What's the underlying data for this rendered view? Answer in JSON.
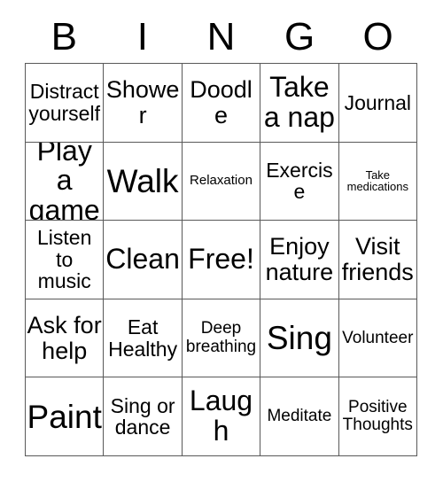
{
  "card": {
    "title_letters": [
      "B",
      "I",
      "N",
      "G",
      "O"
    ],
    "border_color": "#595959",
    "background_color": "#ffffff",
    "text_color": "#000000"
  },
  "cells": [
    {
      "text": "Distract yourself",
      "size": "md"
    },
    {
      "text": "Shower",
      "size": "lg"
    },
    {
      "text": "Doodle",
      "size": "lg"
    },
    {
      "text": "Take a nap",
      "size": "xl"
    },
    {
      "text": "Journal",
      "size": "md"
    },
    {
      "text": "Play a game",
      "size": "xl"
    },
    {
      "text": "Walk",
      "size": "xxl"
    },
    {
      "text": "Relaxation",
      "size": "xs"
    },
    {
      "text": "Exercise",
      "size": "md"
    },
    {
      "text": "Take medications",
      "size": "xxs"
    },
    {
      "text": "Listen to music",
      "size": "md"
    },
    {
      "text": "Clean",
      "size": "xl"
    },
    {
      "text": "Free!",
      "size": "xl"
    },
    {
      "text": "Enjoy nature",
      "size": "lg"
    },
    {
      "text": "Visit friends",
      "size": "lg"
    },
    {
      "text": "Ask for help",
      "size": "lg"
    },
    {
      "text": "Eat Healthy",
      "size": "md"
    },
    {
      "text": "Deep breathing",
      "size": "sm"
    },
    {
      "text": "Sing",
      "size": "xxl"
    },
    {
      "text": "Volunteer",
      "size": "sm"
    },
    {
      "text": "Paint",
      "size": "xxl"
    },
    {
      "text": "Sing or dance",
      "size": "md"
    },
    {
      "text": "Laugh",
      "size": "xl"
    },
    {
      "text": "Meditate",
      "size": "sm"
    },
    {
      "text": "Positive Thoughts",
      "size": "sm"
    }
  ]
}
